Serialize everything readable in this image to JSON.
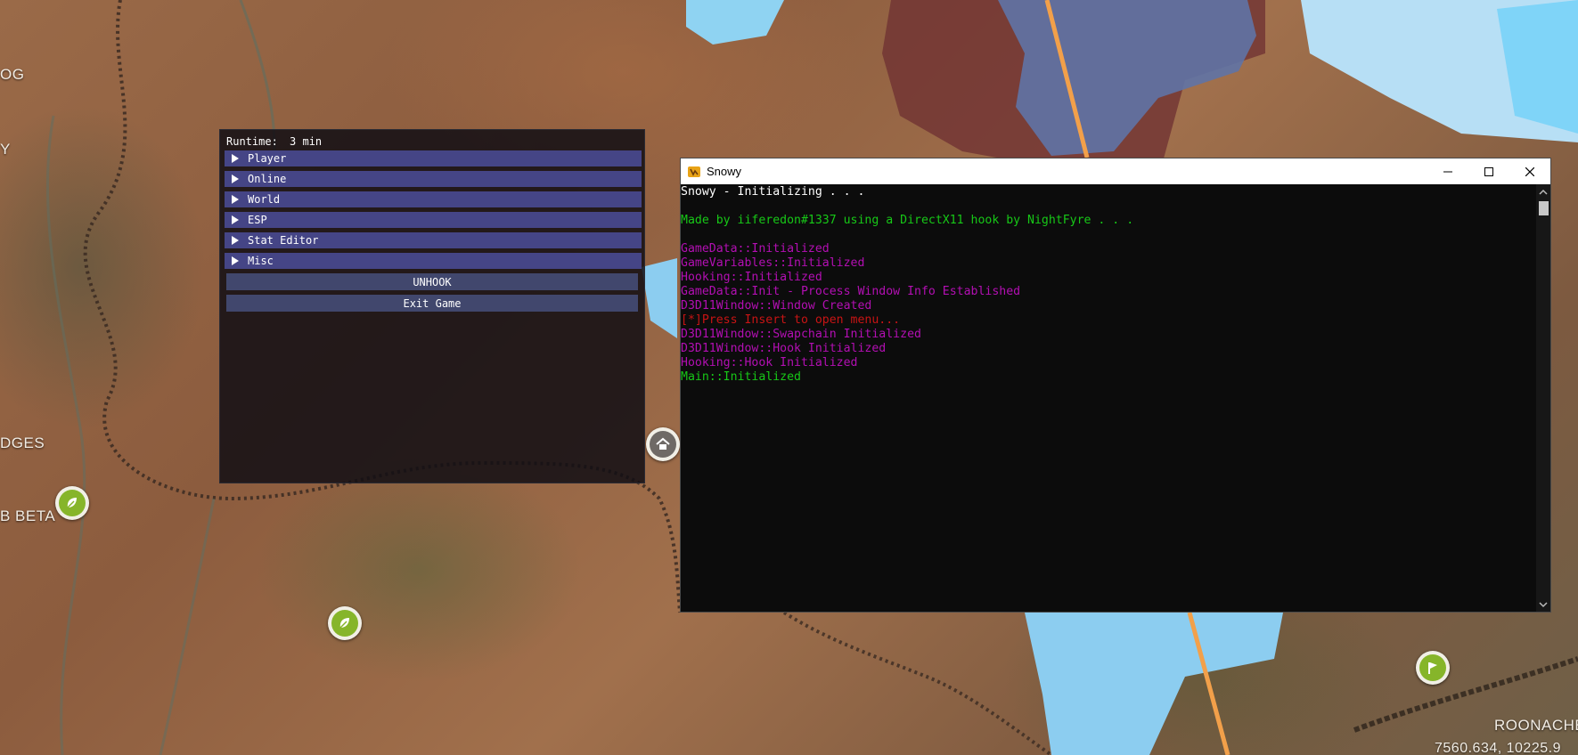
{
  "map": {
    "labels": [
      "OG",
      "Y",
      "DGES",
      "B BETA",
      "ROONACHE",
      "7560.634, 10225.9"
    ]
  },
  "menu": {
    "runtime_label": "Runtime:",
    "runtime_value": "3 min",
    "sections": [
      "Player",
      "Online",
      "World",
      "ESP",
      "Stat Editor",
      "Misc"
    ],
    "unhook_label": "UNHOOK",
    "exit_label": "Exit Game",
    "colors": {
      "header": "#454586",
      "button": "#41476d"
    }
  },
  "console": {
    "title": "Snowy",
    "icons": {
      "minimize": "minimize-icon",
      "maximize": "maximize-icon",
      "close": "close-icon"
    },
    "lines": [
      {
        "text": "Snowy - Initializing . . .",
        "color": "#ffffff"
      },
      {
        "text": "",
        "color": "#ffffff"
      },
      {
        "text": "Made by iiferedon#1337 using a DirectX11 hook by NightFyre . . .",
        "color": "#17c817"
      },
      {
        "text": "",
        "color": "#ffffff"
      },
      {
        "text": "GameData::Initialized",
        "color": "#b30fb3"
      },
      {
        "text": "GameVariables::Initialized",
        "color": "#b30fb3"
      },
      {
        "text": "Hooking::Initialized",
        "color": "#b30fb3"
      },
      {
        "text": "GameData::Init - Process Window Info Established",
        "color": "#b30fb3"
      },
      {
        "text": "D3D11Window::Window Created",
        "color": "#b30fb3"
      },
      {
        "text": "[*]Press Insert to open menu...",
        "color": "#c81414"
      },
      {
        "text": "D3D11Window::Swapchain Initialized",
        "color": "#b30fb3"
      },
      {
        "text": "D3D11Window::Hook Initialized",
        "color": "#b30fb3"
      },
      {
        "text": "Hooking::Hook Initialized",
        "color": "#b30fb3"
      },
      {
        "text": "Main::Initialized",
        "color": "#17c817"
      }
    ]
  }
}
